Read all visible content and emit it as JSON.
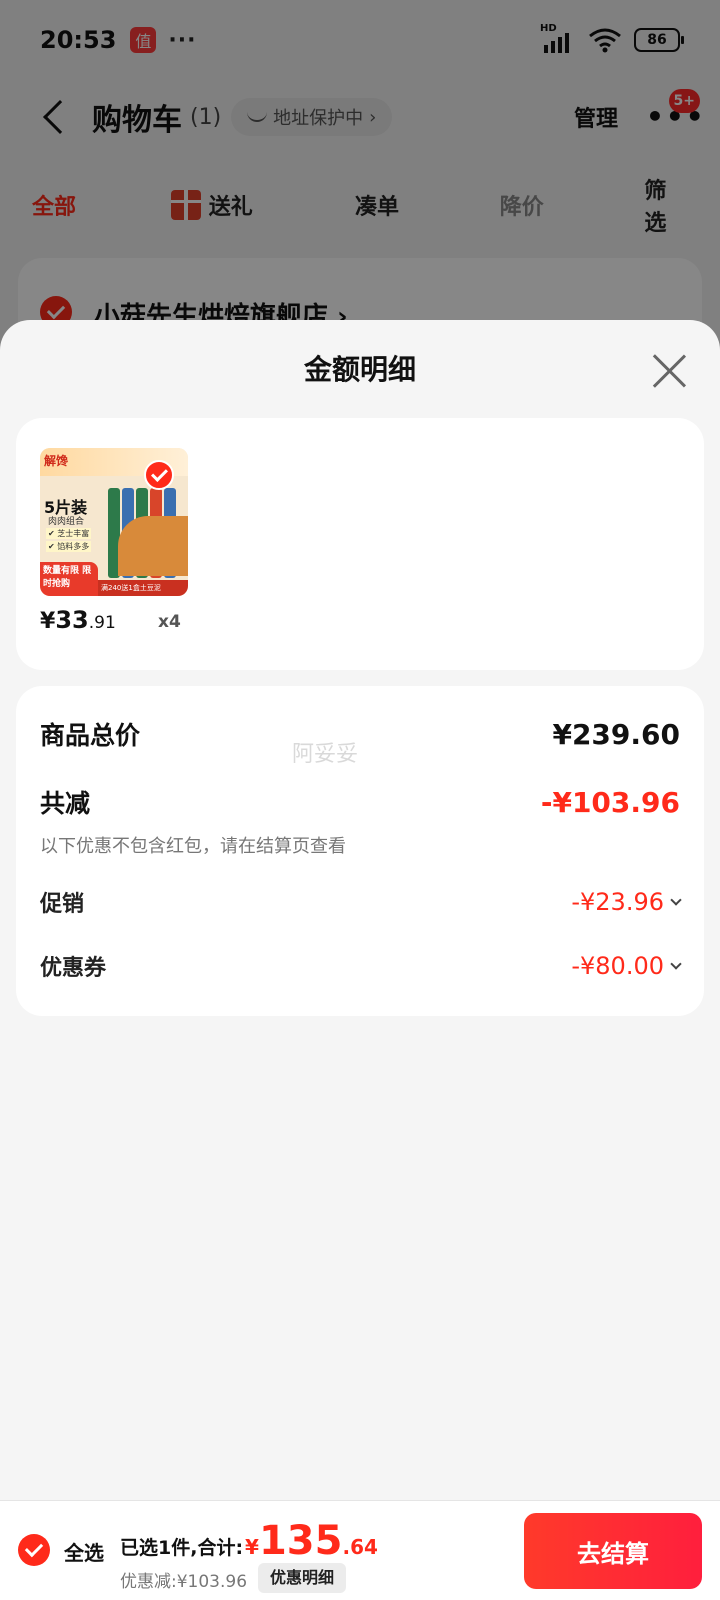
{
  "status_bar": {
    "time": "20:53",
    "badge": "值",
    "dots": "···",
    "hd": "HD",
    "battery": "86"
  },
  "navbar": {
    "title": "购物车",
    "count": "(1)",
    "address_pill": "地址保护中",
    "address_chevron": "›",
    "manage": "管理",
    "more_badge": "5+"
  },
  "tabs": [
    {
      "label": "全部"
    },
    {
      "label": "送礼"
    },
    {
      "label": "凑单"
    },
    {
      "label": "降价"
    },
    {
      "label": "筛选"
    }
  ],
  "store": {
    "name": "小菇先生烘焙旗舰店 ›"
  },
  "sheet": {
    "title": "金额明细",
    "watermark": "阿妥妥",
    "product": {
      "image_texts": {
        "logo": "解馋",
        "pack": "5片装",
        "sub": "肉肉组合",
        "tag1": "✔ 芝士丰富",
        "tag2": "✔ 馅料多多",
        "red_box": "数量有限 限时抢购",
        "bottom": "满240送1盒土豆泥"
      },
      "price_yen": "¥",
      "price_int": "33",
      "price_dec": ".91",
      "quantity": "x4"
    },
    "summary": {
      "total_label": "商品总价",
      "total_value": "¥239.60",
      "discount_label": "共减",
      "discount_value": "-¥103.96",
      "note": "以下优惠不包含红包，请在结算页查看",
      "promo_label": "促销",
      "promo_value": "-¥23.96",
      "coupon_label": "优惠券",
      "coupon_value": "-¥80.00"
    }
  },
  "checkout": {
    "select_all": "全选",
    "selected_text": "已选1件,合计:",
    "total_yen": "¥",
    "total_int": "135",
    "total_dec": ".64",
    "discount_text": "优惠减:¥103.96",
    "detail_button": "优惠明细",
    "pay_button": "去结算"
  },
  "colors": {
    "accent": "#ff2a1a",
    "sheet_bg": "#f5f5f5"
  }
}
